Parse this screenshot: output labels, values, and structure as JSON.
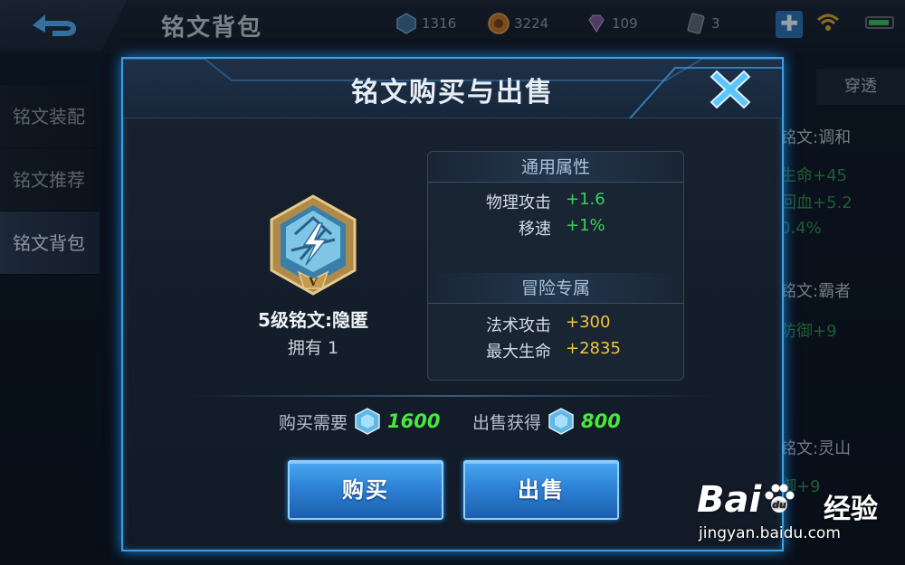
{
  "topbar": {
    "title": "铭文背包",
    "resources": [
      {
        "icon": "crystal-icon",
        "value": "1316"
      },
      {
        "icon": "gold-coin-icon",
        "value": "3224"
      },
      {
        "icon": "diamond-icon",
        "value": "109"
      },
      {
        "icon": "ticket-icon",
        "value": "3"
      }
    ],
    "plus_label": "✚"
  },
  "sidebar": {
    "items": [
      {
        "label": "铭文装配"
      },
      {
        "label": "铭文推荐"
      },
      {
        "label": "铭文背包"
      }
    ]
  },
  "background_list": {
    "tab": "穿透",
    "entries": [
      {
        "name": "铭文:调和",
        "lines": [
          "生命+45",
          "回血+5.2",
          "0.4%"
        ]
      },
      {
        "name": "铭文:霸者",
        "lines": [
          "防御+9"
        ]
      },
      {
        "name": "铭文:灵山",
        "lines": [
          "御+9"
        ]
      }
    ]
  },
  "dialog": {
    "title": "铭文购买与出售",
    "rune": {
      "name": "5级铭文:隐匿",
      "owned": "拥有 1",
      "level_mark": "V"
    },
    "general": {
      "heading": "通用属性",
      "rows": [
        {
          "label": "物理攻击",
          "value": "+1.6"
        },
        {
          "label": "移速",
          "value": "+1%"
        }
      ]
    },
    "adventure": {
      "heading": "冒险专属",
      "rows": [
        {
          "label": "法术攻击",
          "value": "+300"
        },
        {
          "label": "最大生命",
          "value": "+2835"
        }
      ]
    },
    "buy_price": {
      "label": "购买需要",
      "value": "1600"
    },
    "sell_price": {
      "label": "出售获得",
      "value": "800"
    },
    "buy_button": "购买",
    "sell_button": "出售"
  },
  "watermark": {
    "brand_a": "Bai",
    "brand_b": "du",
    "suffix": "经验",
    "url": "jingyan.baidu.com"
  },
  "colors": {
    "accent_blue": "#3aa0e8",
    "bonus_green": "#34d25a",
    "adventure_gold": "#f1c43c",
    "price_green": "#49e83c"
  }
}
